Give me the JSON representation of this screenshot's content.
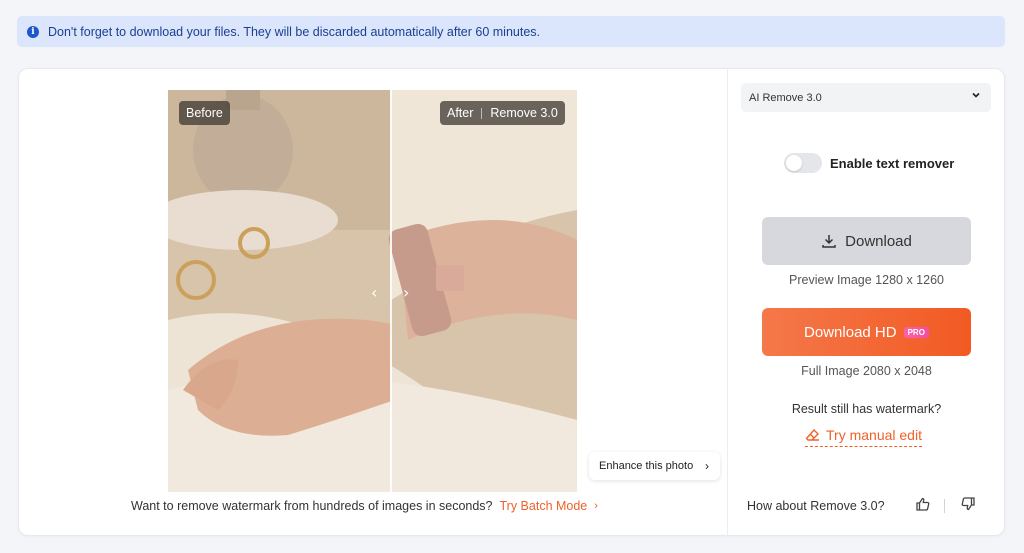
{
  "notice": {
    "icon": "info-icon",
    "text": "Don't forget to download your files. They will be discarded automatically after 60 minutes."
  },
  "compare": {
    "before_label": "Before",
    "after_label": "After",
    "after_model": "Remove 3.0",
    "left_arrow": "‹",
    "right_arrow": "›"
  },
  "enhance": {
    "label": "Enhance this photo",
    "chevron": "›"
  },
  "batch": {
    "text": "Want to remove watermark from hundreds of images in seconds?",
    "link": "Try Batch Mode",
    "chevron": "›"
  },
  "panel": {
    "model_select": "AI Remove 3.0",
    "text_remover_label": "Enable text remover",
    "text_remover_on": false,
    "download_label": "Download",
    "preview_caption": "Preview Image 1280 x 1260",
    "download_hd_label": "Download HD",
    "pro_badge": "PRO",
    "full_caption": "Full Image 2080 x 2048",
    "still_watermark": "Result still has watermark?",
    "manual_edit": "Try manual edit",
    "feedback_question": "How about Remove 3.0?"
  },
  "colors": {
    "accent": "#f0612a",
    "notice_bg": "#dbe6fd",
    "notice_text": "#1b3f8f"
  }
}
